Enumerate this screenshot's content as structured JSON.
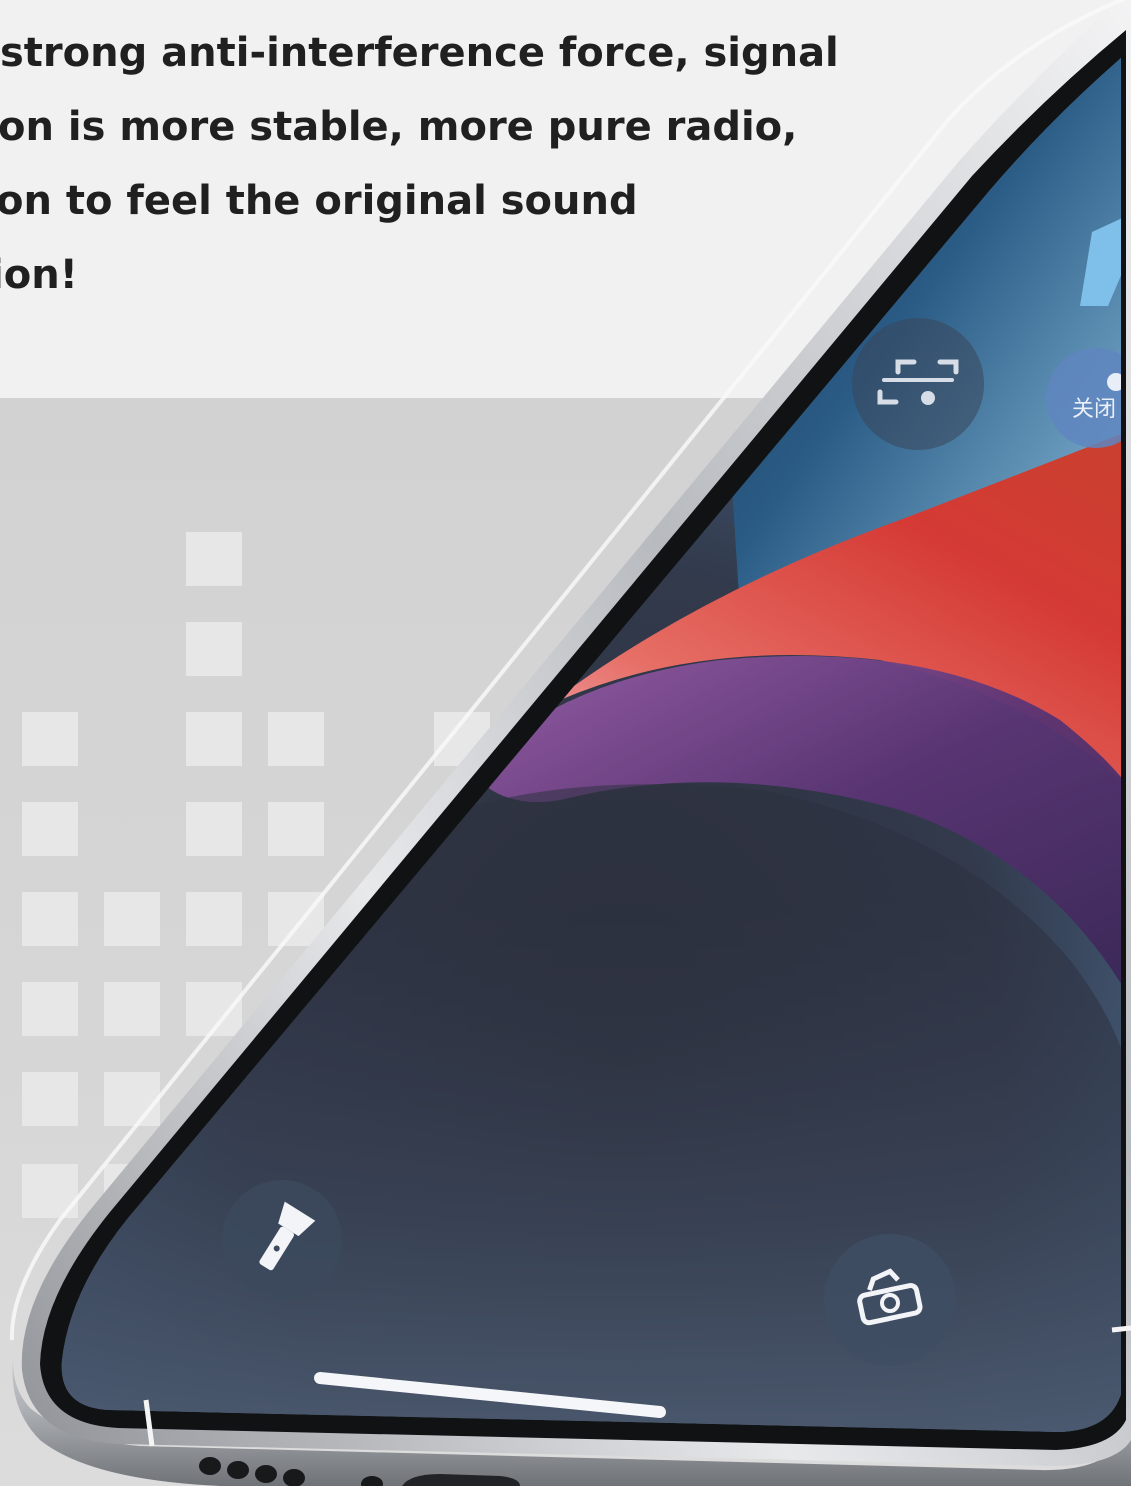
{
  "caption": {
    "lines": [
      "strong anti-interference force, signal",
      "on is more stable, more pure radio,",
      "on to feel the original sound",
      "ion!"
    ]
  },
  "phone_screen": {
    "status_chip_text": "关闭",
    "icons": [
      "scan-icon",
      "flashlight-icon",
      "camera-icon"
    ]
  },
  "colors": {
    "background_top": "#f1f1f1",
    "background_bottom": "#d4d4d4",
    "caption_text": "#202020",
    "screen_dark": "#2b2f3b",
    "wallpaper_red": "#d8453b",
    "wallpaper_purple": "#6a3a80",
    "wallpaper_blue": "#5b7ea0"
  }
}
